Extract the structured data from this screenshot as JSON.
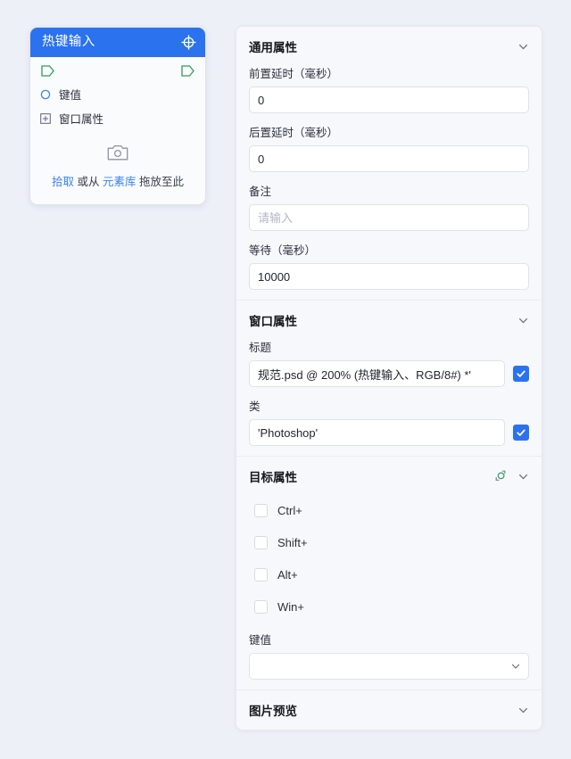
{
  "colors": {
    "background": "#eef0f8",
    "accent": "#2b72ef",
    "link": "#3b82f6",
    "port_green": "#2f9e5e",
    "panel_bg": "#f7f8fb",
    "field_border": "#dfe2ea"
  },
  "node": {
    "title": "热键输入",
    "header_icon": "crosshair-icon",
    "left_port_icon": "input-port-icon",
    "right_port_icon": "output-port-icon",
    "rows": [
      {
        "icon": "circle-icon",
        "label": "键值"
      },
      {
        "icon": "plus-box-icon",
        "label": "窗口属性"
      }
    ],
    "drop_zone": {
      "icon": "camera-icon",
      "pick_label": "拾取",
      "middle_label": "或从",
      "library_label": "元素库",
      "tail_label": "拖放至此"
    }
  },
  "panel": {
    "sections": [
      {
        "title": "通用属性",
        "chevron_icon": "chevron-down-icon",
        "fields": [
          {
            "label": "前置延时（毫秒）",
            "value": "0",
            "placeholder": ""
          },
          {
            "label": "后置延时（毫秒）",
            "value": "0",
            "placeholder": ""
          },
          {
            "label": "备注",
            "value": "",
            "placeholder": "请输入"
          },
          {
            "label": "等待（毫秒）",
            "value": "10000",
            "placeholder": ""
          }
        ]
      },
      {
        "title": "窗口属性",
        "chevron_icon": "chevron-down-icon",
        "fields": [
          {
            "label": "标题",
            "value": "规范.psd @ 200% (热键输入、RGB/8#) *'",
            "placeholder": "",
            "checkbox": "checked"
          },
          {
            "label": "类",
            "value": "'Photoshop'",
            "placeholder": "",
            "checkbox": "checked"
          }
        ]
      },
      {
        "title": "目标属性",
        "chevron_icon": "chevron-down-icon",
        "capture_icon": "capture-target-icon",
        "modifiers": [
          {
            "label": "Ctrl+",
            "checked": false
          },
          {
            "label": "Shift+",
            "checked": false
          },
          {
            "label": "Alt+",
            "checked": false
          },
          {
            "label": "Win+",
            "checked": false
          }
        ],
        "key_field": {
          "label": "键值",
          "selected": "",
          "options": [
            ""
          ],
          "chevron_icon": "chevron-down-icon"
        }
      },
      {
        "title": "图片预览",
        "chevron_icon": "chevron-down-icon"
      }
    ]
  }
}
